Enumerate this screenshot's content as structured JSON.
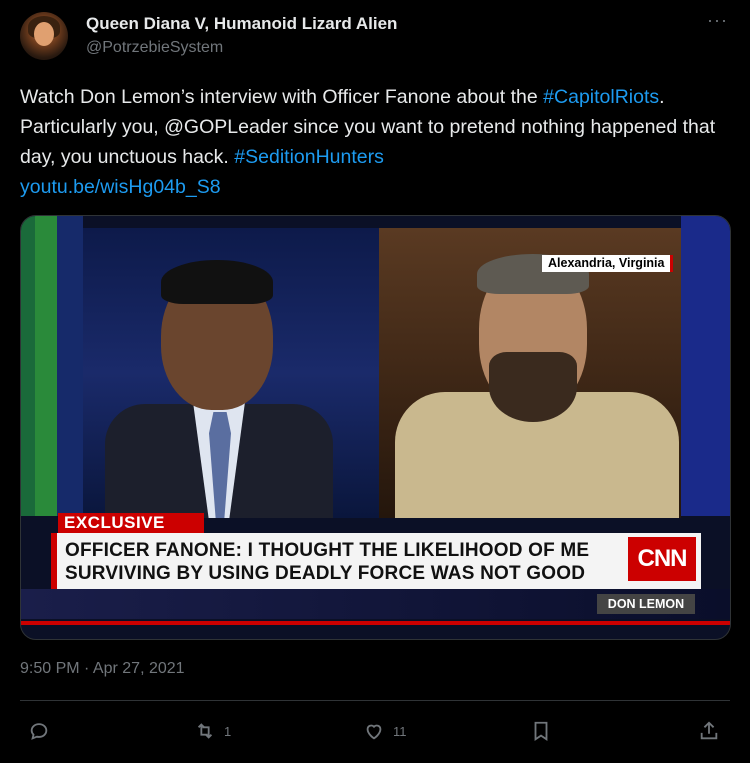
{
  "author": {
    "display_name": "Queen Diana V, Humanoid Lizard Alien",
    "handle": "@PotrzebieSystem"
  },
  "more_icon": "more-horizontal-icon",
  "tweet": {
    "segments": [
      {
        "type": "text",
        "value": "Watch Don Lemon’s interview with Officer Fanone about the "
      },
      {
        "type": "link",
        "value": "#CapitolRiots"
      },
      {
        "type": "text",
        "value": ". Particularly you, @GOPLeader since you want to pretend nothing happened that day, you unctuous hack. "
      },
      {
        "type": "link",
        "value": "#SeditionHunters"
      },
      {
        "type": "linebreak",
        "value": ""
      },
      {
        "type": "link",
        "value": "youtu.be/wisHg04b_S8"
      }
    ]
  },
  "media": {
    "location_tag": "Alexandria, Virginia",
    "exclusive_label": "EXCLUSIVE",
    "headline_line1": "OFFICER FANONE: I THOUGHT THE LIKELIHOOD OF ME",
    "headline_line2": "SURVIVING BY USING DEADLY FORCE WAS NOT GOOD",
    "network_logo": "CNN",
    "anchor_name": "DON LEMON"
  },
  "timestamp": "9:50 PM · Apr 27, 2021",
  "actions": {
    "reply": {
      "icon": "reply-icon",
      "count": ""
    },
    "retweet": {
      "icon": "retweet-icon",
      "count": "1"
    },
    "like": {
      "icon": "heart-icon",
      "count": "11"
    },
    "bookmark": {
      "icon": "bookmark-icon",
      "count": ""
    },
    "share": {
      "icon": "share-icon",
      "count": ""
    }
  },
  "colors": {
    "background": "#000000",
    "text": "#e7e9ea",
    "secondary": "#71767b",
    "link": "#1d9bf0",
    "cnn_red": "#cc0000"
  }
}
